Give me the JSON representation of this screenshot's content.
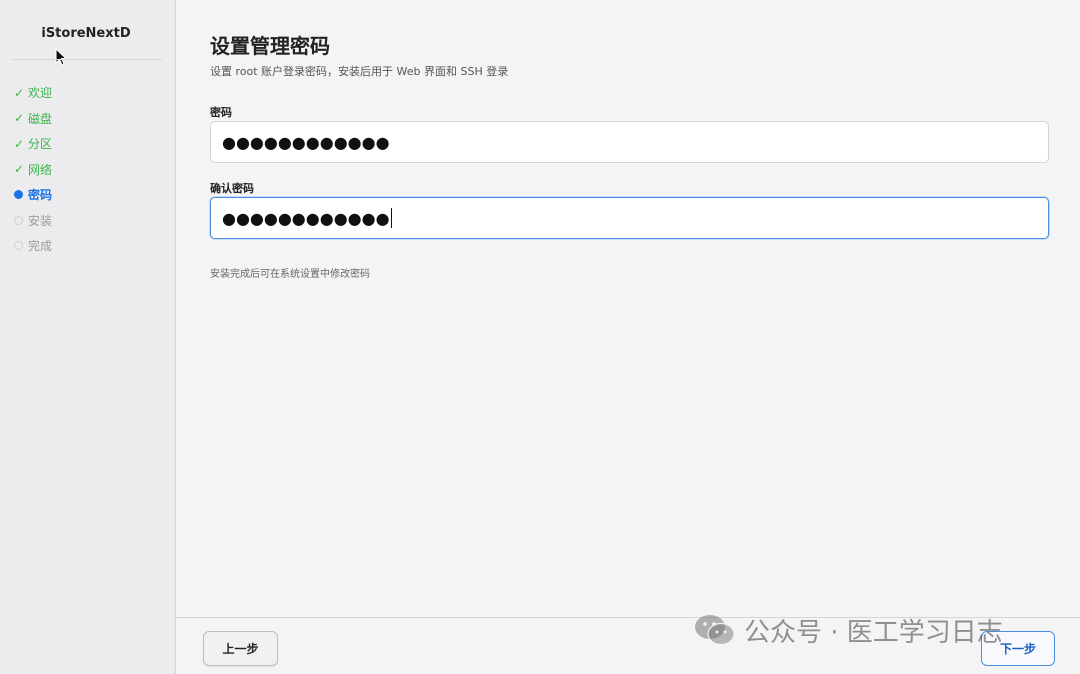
{
  "sidebar": {
    "brand": "iStoreNextD",
    "steps": [
      {
        "label": "欢迎",
        "state": "done"
      },
      {
        "label": "磁盘",
        "state": "done"
      },
      {
        "label": "分区",
        "state": "done"
      },
      {
        "label": "网络",
        "state": "done"
      },
      {
        "label": "密码",
        "state": "active"
      },
      {
        "label": "安装",
        "state": "pending"
      },
      {
        "label": "完成",
        "state": "pending"
      }
    ],
    "check_glyph": "✓"
  },
  "main": {
    "title": "设置管理密码",
    "subtitle": "设置 root 账户登录密码，安装后用于 Web 界面和 SSH 登录",
    "password": {
      "label": "密码",
      "value": "●●●●●●●●●●●●"
    },
    "confirm": {
      "label": "确认密码",
      "value": "●●●●●●●●●●●●"
    },
    "hint": "安装完成后可在系统设置中修改密码"
  },
  "footer": {
    "prev_label": "上一步",
    "next_label": "下一步"
  },
  "watermark": {
    "text": "公众号 · 医工学习日志"
  },
  "colors": {
    "done": "#3bb54a",
    "active": "#1a73e8",
    "pending": "#9a9a9a",
    "focus_border": "#4a90e2"
  }
}
